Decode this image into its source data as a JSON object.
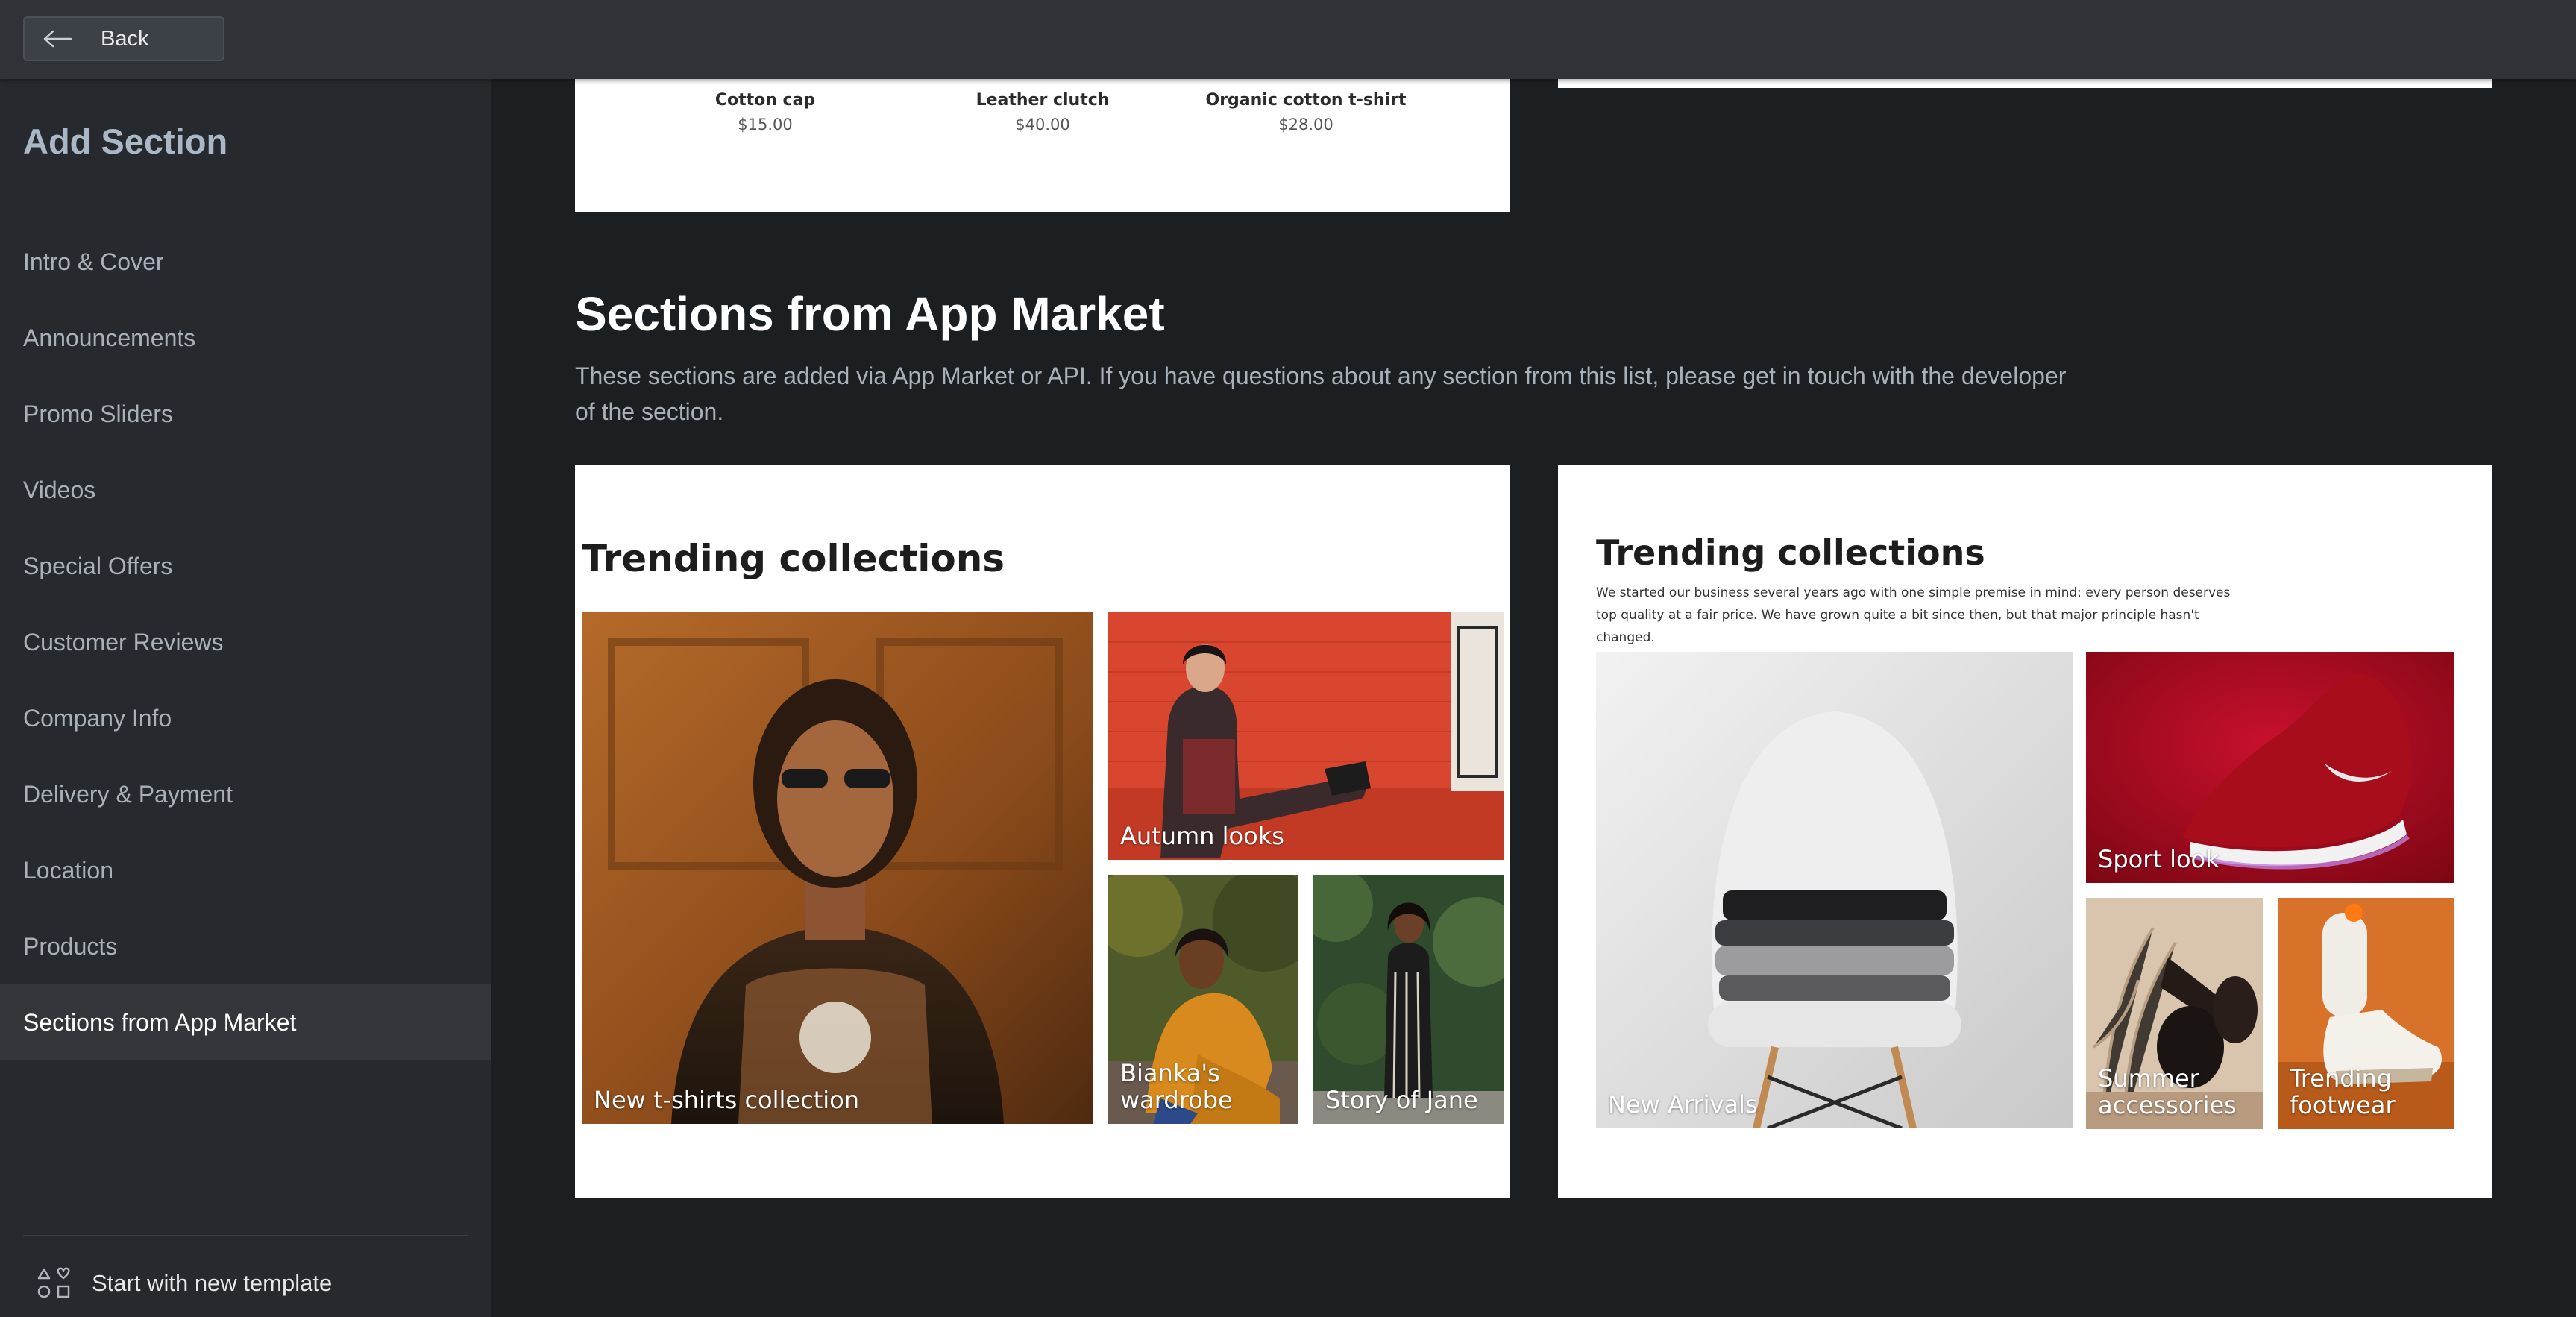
{
  "topbar": {
    "back_label": "Back"
  },
  "sidebar": {
    "title": "Add Section",
    "items": [
      {
        "label": "Intro & Cover"
      },
      {
        "label": "Announcements"
      },
      {
        "label": "Promo Sliders"
      },
      {
        "label": "Videos"
      },
      {
        "label": "Special Offers"
      },
      {
        "label": "Customer Reviews"
      },
      {
        "label": "Company Info"
      },
      {
        "label": "Delivery & Payment"
      },
      {
        "label": "Location"
      },
      {
        "label": "Products"
      },
      {
        "label": "Sections from App Market",
        "active": true
      }
    ],
    "new_template_label": "Start with new template"
  },
  "products_preview": {
    "items": [
      {
        "name": "Cotton cap",
        "price": "$15.00"
      },
      {
        "name": "Leather clutch",
        "price": "$40.00"
      },
      {
        "name": "Organic cotton t-shirt",
        "price": "$28.00"
      }
    ]
  },
  "app_market": {
    "heading": "Sections from App Market",
    "description": "These sections are added via App Market or API. If you have questions about any section from this list, please get in touch with the developer of the section."
  },
  "card_left": {
    "title": "Trending collections",
    "tiles": [
      {
        "label": "New t-shirts collection"
      },
      {
        "label": "Autumn looks"
      },
      {
        "label": "Bianka's wardrobe"
      },
      {
        "label": "Story of Jane"
      }
    ]
  },
  "card_right": {
    "title": "Trending collections",
    "subtitle": "We started our business several years ago with one simple premise in mind: every person deserves top quality at a fair price. We have grown quite a bit since then, but that major principle hasn't changed.",
    "tiles": [
      {
        "label": "New Arrivals"
      },
      {
        "label": "Sport look"
      },
      {
        "label": "Summer accessories"
      },
      {
        "label": "Trending footwear"
      }
    ]
  },
  "colors": {
    "background": "#1c1f22",
    "sidebar": "#26292d",
    "topbar": "#2f3338",
    "active_item": "#33373c",
    "sidebar_title": "#a9b7c6"
  }
}
